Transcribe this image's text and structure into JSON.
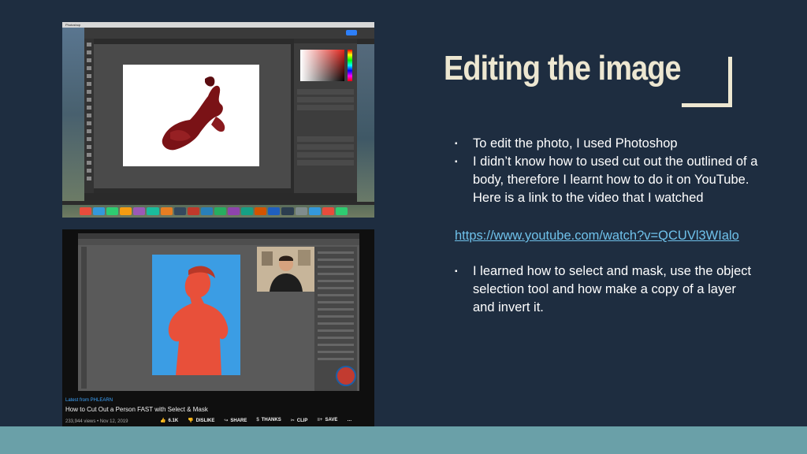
{
  "slide": {
    "title": "Editing the image",
    "bullets_group1": [
      "To edit the photo, I used Photoshop",
      "I didn’t know how to used cut out the outlined of a body, therefore I learnt how to do it on YouTube. Here is a link to the video that I watched"
    ],
    "link": "https://www.youtube.com/watch?v=QCUVl3WIalo",
    "bullets_group2": [
      "I learned how to select and mask, use the object selection tool and how make a copy of a layer and invert it."
    ],
    "bullet_mark": "▪"
  },
  "photoshop_shot": {
    "menu_app": "Photoshop"
  },
  "youtube_shot": {
    "latest_label": "Latest from PHLEARN",
    "video_title": "How to Cut Out a Person FAST with Select & Mask",
    "meta": "233,944 views • Nov 12, 2019",
    "likes": "6.1K",
    "dislike": "DISLIKE",
    "share": "SHARE",
    "thanks": "THANKS",
    "clip": "CLIP",
    "save": "SAVE",
    "more": "…"
  },
  "colors": {
    "background": "#1e2d40",
    "title": "#ede7d1",
    "link": "#6fc1ea",
    "band": "#6aa0a8"
  }
}
